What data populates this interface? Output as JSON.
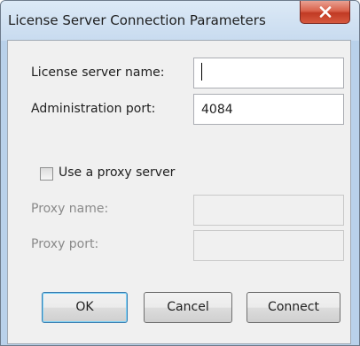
{
  "window": {
    "title": "License Server Connection Parameters",
    "close_icon": "close-x-icon"
  },
  "form": {
    "server_name": {
      "label": "License server name:",
      "value": ""
    },
    "admin_port": {
      "label": "Administration port:",
      "value": "4084"
    },
    "use_proxy": {
      "label": "Use a proxy server",
      "checked": false
    },
    "proxy_name": {
      "label": "Proxy name:",
      "value": "",
      "enabled": false
    },
    "proxy_port": {
      "label": "Proxy port:",
      "value": "",
      "enabled": false
    }
  },
  "buttons": {
    "ok": "OK",
    "cancel": "Cancel",
    "connect": "Connect"
  }
}
